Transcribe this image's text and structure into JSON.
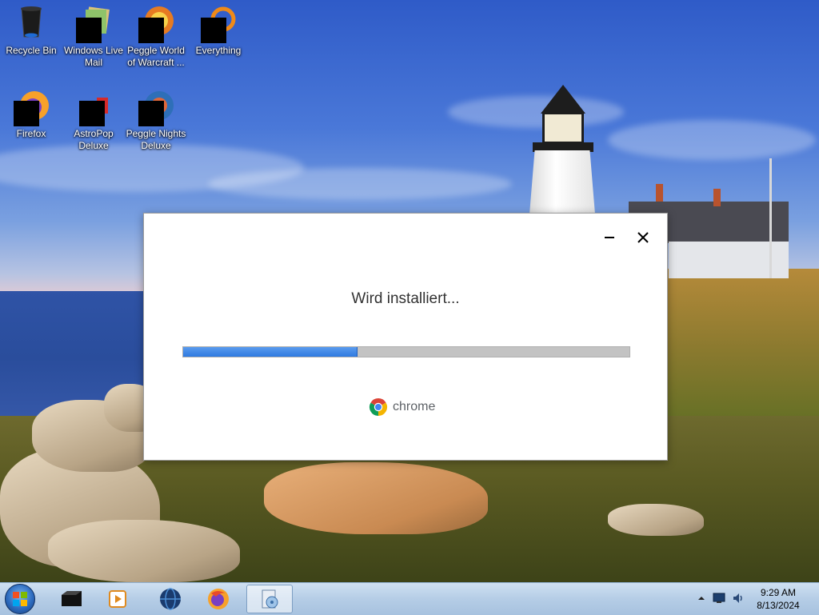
{
  "desktop": {
    "icons": [
      {
        "label": "Recycle Bin",
        "icon": "recycle-bin-icon"
      },
      {
        "label": "Windows Live Mail",
        "icon": "windows-live-mail-icon"
      },
      {
        "label": "Peggle World of Warcraft ...",
        "icon": "peggle-wow-icon"
      },
      {
        "label": "Everything",
        "icon": "everything-search-icon"
      },
      {
        "label": "Firefox",
        "icon": "firefox-icon"
      },
      {
        "label": "AstroPop Deluxe",
        "icon": "astropop-icon"
      },
      {
        "label": "Peggle Nights Deluxe",
        "icon": "peggle-nights-icon"
      }
    ]
  },
  "installer": {
    "status": "Wird installiert...",
    "progress_fraction": 0.39,
    "brand": "chrome",
    "minimize_icon": "minimize-icon",
    "close_icon": "close-icon",
    "accent": "#3d86e6"
  },
  "taskbar": {
    "start_icon": "windows-start-icon",
    "pinned": [
      {
        "icon": "terminal-icon"
      },
      {
        "icon": "media-player-icon"
      },
      {
        "icon": "globe-browser-icon"
      },
      {
        "icon": "firefox-icon"
      },
      {
        "icon": "installer-setup-icon",
        "active": true
      }
    ],
    "tray": {
      "show_hidden_icon": "chevron-up-icon",
      "network_icon": "network-icon",
      "volume_icon": "volume-icon"
    },
    "clock": {
      "time": "9:29 AM",
      "date": "8/13/2024"
    }
  }
}
